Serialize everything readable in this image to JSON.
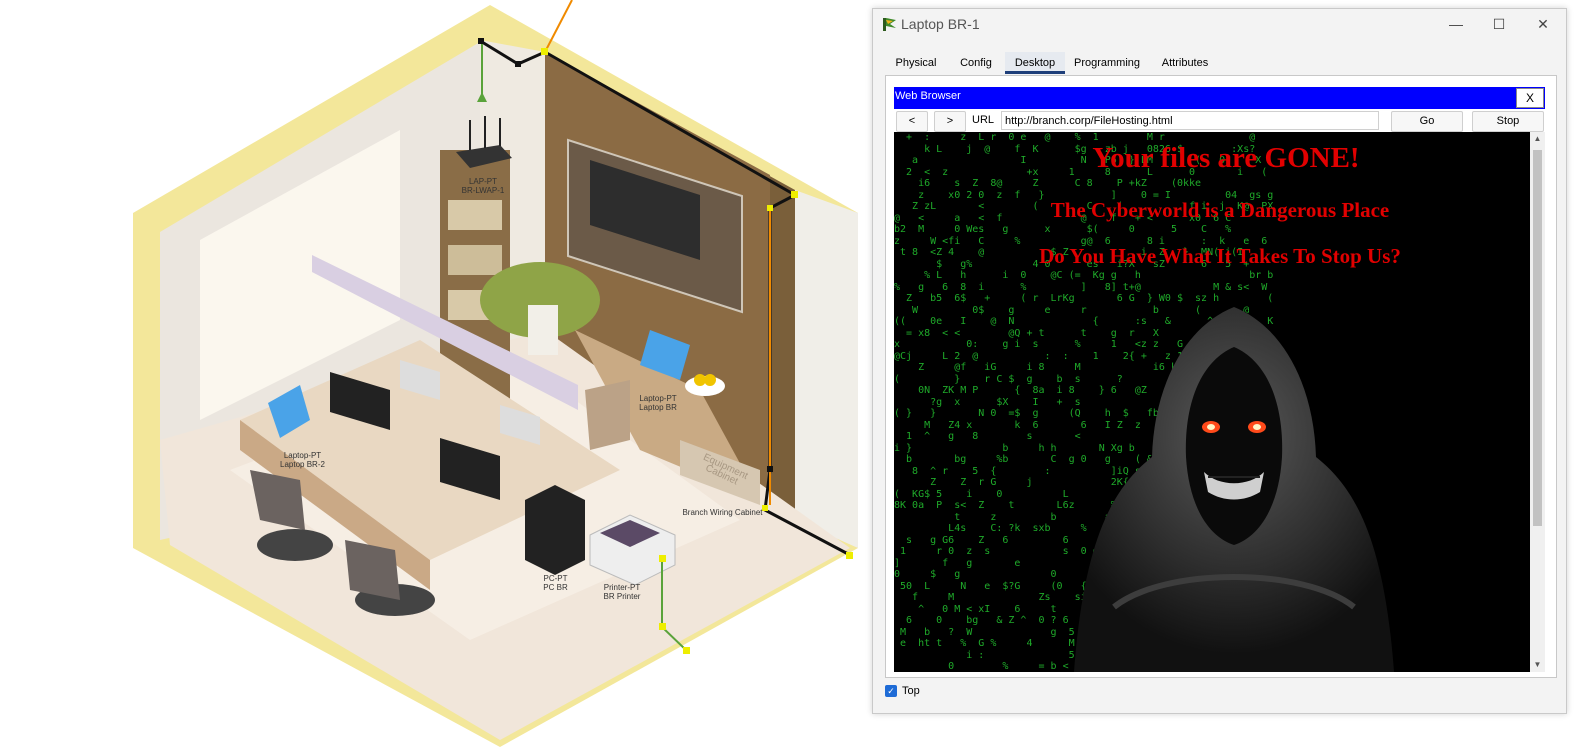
{
  "room": {
    "labels": {
      "lap_pt": "LAP-PT\nBR-LWAP-1",
      "laptop_pt_br": "Laptop-PT\nLaptop BR",
      "laptop_pt_br2": "Laptop-PT\nLaptop BR-2",
      "equipment_cabinet": "Equipment Cabinet",
      "branch_wiring": "Branch Wiring Cabinet",
      "pc_pt": "PC-PT\nPC BR",
      "printer_pt": "Printer-PT\nBR Printer"
    }
  },
  "window": {
    "title": "Laptop BR-1",
    "controls": {
      "minimize": "—",
      "maximize": "☐",
      "close": "✕"
    },
    "tabs": [
      {
        "label": "Physical"
      },
      {
        "label": "Config"
      },
      {
        "label": "Desktop"
      },
      {
        "label": "Programming"
      },
      {
        "label": "Attributes"
      }
    ],
    "active_tab": "Desktop",
    "browser": {
      "title": "Web Browser",
      "close_label": "X",
      "back_label": "<",
      "forward_label": ">",
      "url_label": "URL",
      "url_value": "http://branch.corp/FileHosting.html",
      "go_label": "Go",
      "stop_label": "Stop",
      "page": {
        "headline1": "Your files are GONE!",
        "headline2": "The Cyberworld is a Dangerous Place",
        "headline3": "Do You Have What It Takes To Stop Us?"
      }
    },
    "top_checkbox": {
      "label": "Top",
      "checked": true
    }
  },
  "colors": {
    "browser_header": "#0000ff",
    "headline": "#e10000",
    "matrix_green": "#1faa2a",
    "active_tab_underline": "#1f3f7a"
  }
}
